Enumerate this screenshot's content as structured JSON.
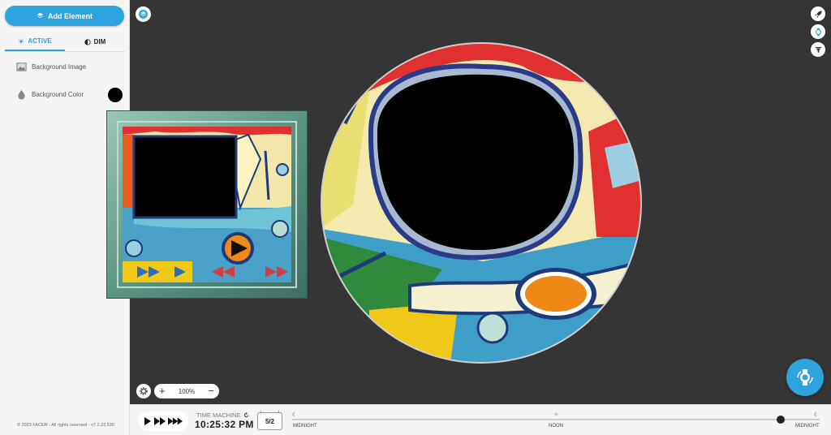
{
  "sidebar": {
    "add_element_label": "Add Element",
    "tabs": [
      {
        "label": "ACTIVE",
        "active": true
      },
      {
        "label": "DIM",
        "active": false
      }
    ],
    "items": [
      {
        "label": "Background Image",
        "icon": "image-icon"
      },
      {
        "label": "Background Color",
        "icon": "droplet-icon",
        "color": "#000000"
      }
    ],
    "copyright": "© 2023 FACER - All rights reserved - v7.1.23.530"
  },
  "canvas": {
    "zoom_label": "100%",
    "zoom_in": "+",
    "zoom_out": "−",
    "accent_color": "#2ea3dd"
  },
  "time_machine": {
    "label": "TIME MACHINE",
    "time": "10:25:32 PM",
    "date": "5/2",
    "timeline_labels": [
      "MIDNIGHT",
      "NOON",
      "MIDNIGHT"
    ],
    "timeline_icons": [
      "moon-icon",
      "sun-icon",
      "moon-icon"
    ],
    "timeline_progress": 0.94
  }
}
